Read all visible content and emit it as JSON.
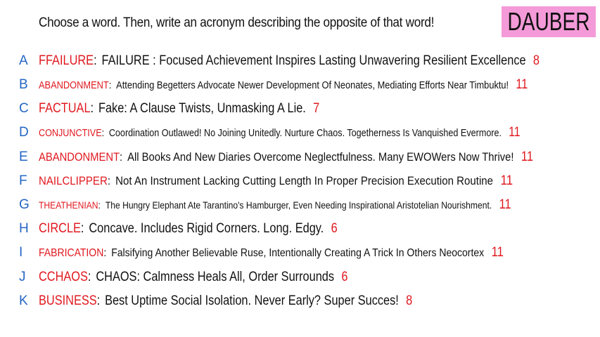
{
  "header": {
    "prompt": "Choose a word. Then, write an acronym describing the opposite of that word!",
    "brand": "DAUBER"
  },
  "colors": {
    "letter": "#2466c4",
    "word": "#e0181f",
    "count": "#e0181f",
    "brand_background": "#f49ad8"
  },
  "answers": [
    {
      "letter": "A",
      "word": "FFAILURE",
      "acronym": "FAILURE : Focused Achievement Inspires Lasting Unwavering Resilient Excellence",
      "count": "8"
    },
    {
      "letter": "B",
      "word": "ABANDONMENT",
      "acronym": "Attending Begetters Advocate Newer Development Of Neonates, Mediating Efforts Near Timbuktu!",
      "count": "11"
    },
    {
      "letter": "C",
      "word": "FACTUAL",
      "acronym": "Fake: A Clause Twists, Unmasking A Lie.",
      "count": "7"
    },
    {
      "letter": "D",
      "word": "CONJUNCTIVE",
      "acronym": "Coordination Outlawed! No Joining Unitedly. Nurture Chaos. Togetherness Is Vanquished Evermore.",
      "count": "11"
    },
    {
      "letter": "E",
      "word": "ABANDONMENT",
      "acronym": "All Books And New Diaries Overcome Neglectfulness. Many EWOWers Now Thrive!",
      "count": "11"
    },
    {
      "letter": "F",
      "word": "NAILCLIPPER",
      "acronym": "Not An Instrument Lacking Cutting Length In Proper Precision Execution Routine",
      "count": "11"
    },
    {
      "letter": "G",
      "word": "THEATHENIAN",
      "acronym": "The Hungry Elephant Ate Tarantino's Hamburger, Even Needing Inspirational Aristotelian Nourishment.",
      "count": "11"
    },
    {
      "letter": "H",
      "word": "CIRCLE",
      "acronym": "Concave. Includes Rigid Corners. Long. Edgy.",
      "count": "6"
    },
    {
      "letter": "I",
      "word": "FABRICATION",
      "acronym": "Falsifying Another Believable Ruse, Intentionally Creating A Trick In Others Neocortex",
      "count": "11"
    },
    {
      "letter": "J",
      "word": "CCHAOS",
      "acronym": "CHAOS: Calmness Heals All, Order Surrounds",
      "count": "6"
    },
    {
      "letter": "K",
      "word": "BUSINESS",
      "acronym": "Best Uptime Social Isolation. Never Early? Super Succes!",
      "count": "8"
    }
  ]
}
